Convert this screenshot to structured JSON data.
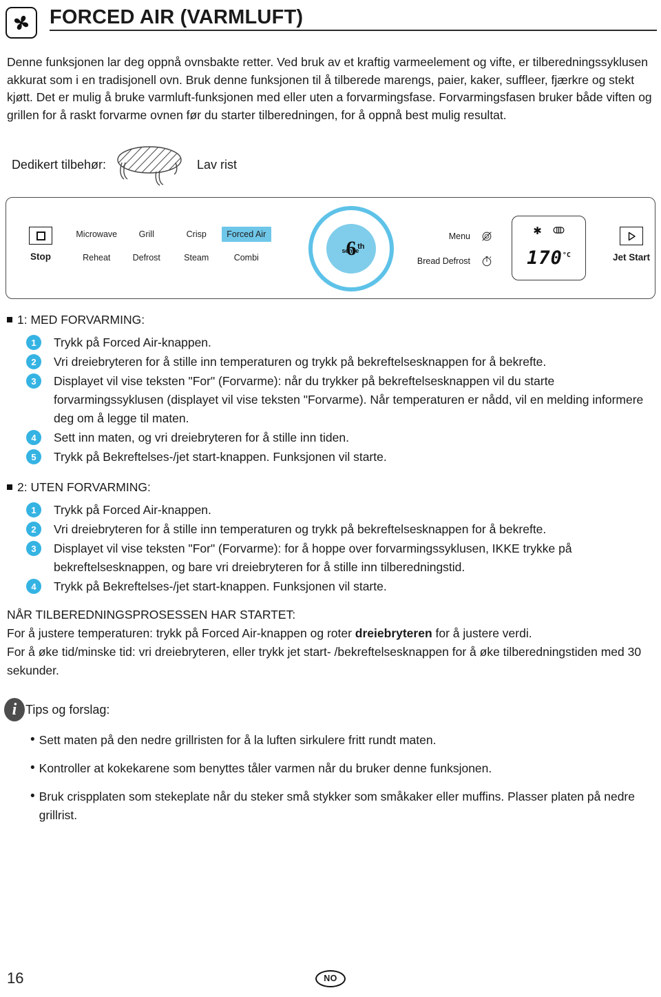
{
  "header": {
    "icon": "fan-icon",
    "title": "FORCED AIR (VARMLUFT)"
  },
  "intro": {
    "paragraph": "Denne funksjonen lar deg oppnå ovnsbakte retter. Ved bruk av et kraftig varmeelement og vifte, er tilberedningssyklusen akkurat som i en tradisjonell ovn. Bruk denne funksjonen til å tilberede marengs, paier, kaker, suffleer, fjærkre og stekt kjøtt. Det er mulig å bruke varmluft-funksjonen med eller uten a forvarmingsfase. Forvarmingsfasen bruker både viften og grillen for å raskt forvarme ovnen før du starter tilberedningen, for å oppnå best mulig resultat."
  },
  "accessory": {
    "label": "Dedikert tilbehør:",
    "image_name": "low-rack-icon",
    "name": "Lav rist"
  },
  "panel": {
    "stop": {
      "label": "Stop",
      "icon": "stop-square-icon"
    },
    "modes_row1": [
      "Microwave",
      "Grill",
      "Crisp",
      "Forced Air"
    ],
    "modes_row2": [
      "Reheat",
      "Defrost",
      "Steam",
      "Combi"
    ],
    "highlighted_mode": "Forced Air",
    "highlight_color": "#6ec7e9",
    "knob": {
      "digit": "6",
      "superscript": "th",
      "word": "sense",
      "ring_color": "#5ec2e8",
      "fill_color": "#7fcdea"
    },
    "menu_items": [
      {
        "label": "Menu",
        "icon": "crossed-plate-icon"
      },
      {
        "label": "Bread Defrost",
        "icon": "timer-icon"
      }
    ],
    "display": {
      "icons": [
        "snowflake-icon",
        "fan-heater-icon"
      ],
      "value": "170",
      "unit": "°C"
    },
    "jet_start": {
      "label": "Jet Start",
      "icon": "play-triangle-icon"
    }
  },
  "procedures": [
    {
      "heading": "1: MED FORVARMING:",
      "steps": [
        {
          "num": "1",
          "text": "Trykk på Forced Air-knappen."
        },
        {
          "num": "2",
          "text": "Vri dreiebryteren for å stille inn temperaturen og trykk på bekreftelsesknappen for å bekrefte."
        },
        {
          "num": "3",
          "text": "Displayet  vil vise teksten \"For\" (Forvarme): når du trykker på bekreftelsesknappen vil du starte forvarmingssyklusen (displayet vil vise teksten \"Forvarme). Når temperaturen er nådd, vil en melding informere deg om å legge til maten."
        },
        {
          "num": "4",
          "text": "Sett inn maten, og vri dreiebryteren for å stille inn tiden."
        },
        {
          "num": "5",
          "text": "Trykk på Bekreftelses-/jet start-knappen. Funksjonen vil starte."
        }
      ]
    },
    {
      "heading": "2: UTEN FORVARMING:",
      "steps": [
        {
          "num": "1",
          "text": "Trykk på Forced Air-knappen."
        },
        {
          "num": "2",
          "text": "Vri dreiebryteren for å stille inn temperaturen og trykk på bekreftelsesknappen for å bekrefte."
        },
        {
          "num": "3",
          "text": "Displayet vil vise teksten \"For\" (Forvarme): for å hoppe over forvarmingssyklusen, IKKE trykke på bekreftelsesknappen, og bare vri dreiebryteren for å stille inn tilberedningstid."
        },
        {
          "num": "4",
          "text": "Trykk på Bekreftelses-/jet start-knappen. Funksjonen vil starte."
        }
      ]
    }
  ],
  "note": {
    "heading": "NÅR TILBEREDNINGSPROSESSEN HAR STARTET:",
    "line1_a": "For å justere temperaturen: trykk på Forced Air-knappen og roter ",
    "line1_b": "dreiebryteren",
    "line1_c": " for å justere verdi.",
    "line2": "For å øke tid/minske tid: vri dreiebryteren, eller trykk jet start- /bekreftelsesknappen for å øke tilberedningstiden med 30 sekunder."
  },
  "tips": {
    "icon": "info-icon",
    "title": "Tips og forslag:",
    "items": [
      "Sett maten på den nedre grillristen for å la luften sirkulere fritt rundt maten.",
      "Kontroller at kokekarene som benyttes tåler varmen når du bruker denne funksjonen.",
      "Bruk crispplaten som stekeplate når du steker små stykker som småkaker eller muffins. Plasser platen på nedre grillrist."
    ]
  },
  "footer": {
    "page_number": "16",
    "language_badge": "NO"
  }
}
